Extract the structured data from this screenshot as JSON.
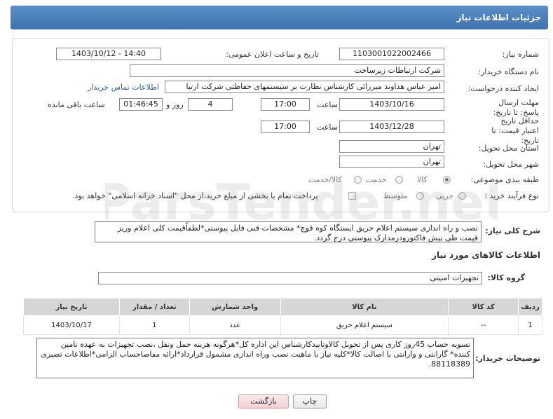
{
  "header": {
    "title": "جزئیات اطلاعات نیاز"
  },
  "form": {
    "need_number": {
      "label": "شماره نیاز:",
      "value": "1103001022002466"
    },
    "announce": {
      "label": "تاریخ و ساعت اعلان عمومی:",
      "value": "1403/10/12 - 14:40"
    },
    "buyer": {
      "label": "نام دستگاه خریدار:",
      "value": "شرکت ارتباطات زیرساخت"
    },
    "creator": {
      "label": "ایجاد کننده درخواست:",
      "value": "امیر عباس هداوند میرزائی کارشناس نظارت بر سیستمهای حفاظتی شرکت ارتبا",
      "contact_link": "اطلاعات تماس خریدار"
    },
    "deadline": {
      "label": "مهلت ارسال پاسخ: تا تاریخ:",
      "date": "1403/10/16",
      "time_label": "ساعت",
      "time": "17:00",
      "days": "4",
      "days_label": "روز و",
      "remaining": "01:46:45",
      "remaining_label": "ساعت باقی مانده"
    },
    "validity": {
      "label": "حداقل تاریخ اعتبار قیمت: تا تاریخ:",
      "date": "1403/12/28",
      "time_label": "ساعت",
      "time": "17:00"
    },
    "province": {
      "label": "استان محل تحویل:",
      "value": "تهران"
    },
    "city": {
      "label": "شهر محل تحویل:",
      "value": "تهران"
    },
    "category": {
      "label": "طبقه بندی موضوعی:",
      "options": [
        "کالا",
        "خدمت",
        "کالا/خدمت"
      ],
      "selected": "کالا"
    },
    "purchase_type": {
      "label": "نوع فرآیند خرید :",
      "options": [
        "جزیی",
        "متوسط"
      ],
      "selected": "",
      "payment_note": "پرداخت تمام یا بخشی از مبلغ خرید،از محل \"اسناد خزانه اسلامی\" خواهد بود."
    }
  },
  "description": {
    "label": "شرح کلی نیاز:",
    "text": "نصب و راه اندازی سیستم اعلام حریق ایستگاه کوه قوچ* مشخصات فنی فایل پیوستی*لطفاًقیمت کلی اعلام وریز قیمت طی پیش فاکتورودرمدارک پیوستی درج گردد."
  },
  "goods_section": {
    "title": "اطلاعات کالاهای مورد نیاز"
  },
  "goods_group": {
    "label": "گروه کالا:",
    "value": "تجهیزات امنیتی"
  },
  "table": {
    "headers": [
      "ردیف",
      "کد کالا",
      "نام کالا",
      "واحد شمارش",
      "تعداد / مقدار",
      "تاریخ نیاز"
    ],
    "rows": [
      [
        "1",
        "--",
        "سیستم اعلام حریق",
        "عدد",
        "1",
        "1403/10/17"
      ]
    ]
  },
  "buyer_notes": {
    "label": "توضیحات خریدار:",
    "text": "تسویه حساب 45روز کاری پس از تحویل کالاوتاییدکارشناس این اداره کل*هرگونه هزینه حمل ونقل ،نصب تجهیزات به عهده تامین کننده* گارانتی و وارانتی با اصالت کالا*کلیه نیاز با ماهیت نصب وراه اندازی مشمول قرارداد*ارائه مفاصاحساب الزامی*اطلاعات تصیری 88118389."
  },
  "buttons": {
    "print": "چاپ",
    "back": "بازگشت"
  },
  "watermark": {
    "text": "ParsTender.net"
  },
  "colors": {
    "header": "#3f73b0",
    "link": "#1a5fb4"
  }
}
